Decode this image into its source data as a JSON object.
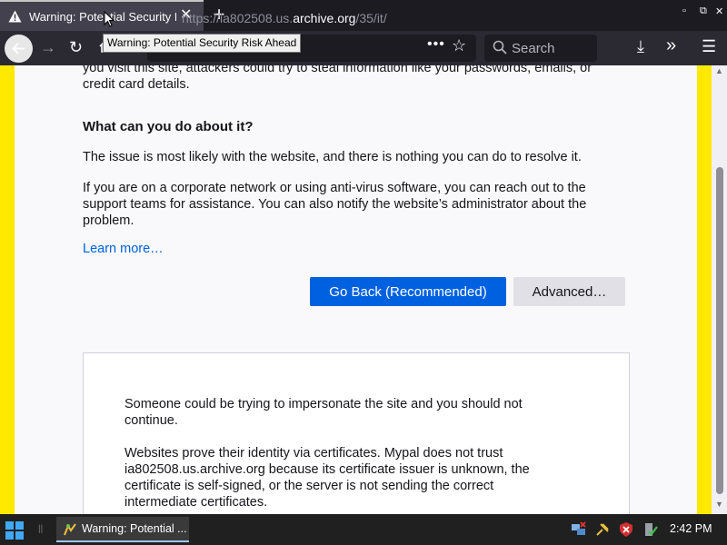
{
  "tab": {
    "title": "Warning: Potential Security Risk Ahead",
    "close": "✕"
  },
  "new_tab": "+",
  "window": {
    "minimize": "▫",
    "restore": "⧉",
    "close": "✕"
  },
  "tooltip": "Warning: Potential Security Risk Ahead",
  "toolbar": {
    "url_prefix": "https://ia802508.us.",
    "url_domain": "archive.org",
    "url_suffix": "/35/it/",
    "page_actions": "•••",
    "bookmark": "☆",
    "search_placeholder": "Search",
    "forward": "→",
    "reload": "↻",
    "download": "⤓",
    "overflow": "»",
    "menu": "☰"
  },
  "content": {
    "intro_tail": "you visit this site, attackers could try to steal information like your passwords, emails, or credit card details.",
    "heading": "What can you do about it?",
    "p1": "The issue is most likely with the website, and there is nothing you can do to resolve it.",
    "p2": "If you are on a corporate network or using anti-virus software, you can reach out to the support teams for assistance. You can also notify the website’s administrator about the problem.",
    "learn_more": "Learn more…",
    "go_back": "Go Back (Recommended)",
    "advanced": "Advanced…",
    "adv_p1": "Someone could be trying to impersonate the site and you should not continue.",
    "adv_p2": "Websites prove their identity via certificates. Mypal does not trust ia802508.us.archive.org because its certificate issuer is unknown, the certificate is self-signed, or the server is not sending the correct intermediate certificates."
  },
  "taskbar": {
    "task_label": "Warning: Potential ...",
    "time": "2:42 PM"
  },
  "colors": {
    "accent": "#0061e0",
    "warning_stripe": "#ffe900"
  }
}
